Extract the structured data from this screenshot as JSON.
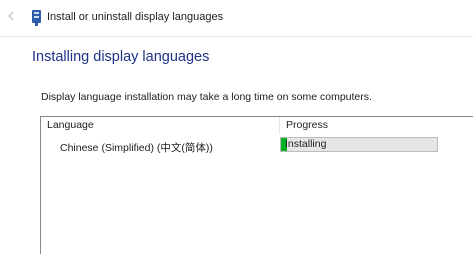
{
  "window": {
    "title": "Install or uninstall display languages"
  },
  "page": {
    "heading": "Installing display languages",
    "description": "Display language installation may take a long time on some computers."
  },
  "list": {
    "columns": [
      "Language",
      "Progress"
    ],
    "rows": [
      {
        "language": "Chinese (Simplified) (中文(简体))",
        "status": "Installing",
        "progress_fraction": 0.04
      }
    ]
  },
  "colors": {
    "heading": "#1e3287",
    "progress_fill": "#06b025",
    "progress_track": "#e6e6e6"
  },
  "icons": {
    "back": "back-arrow-icon",
    "app": "language-settings-icon"
  }
}
